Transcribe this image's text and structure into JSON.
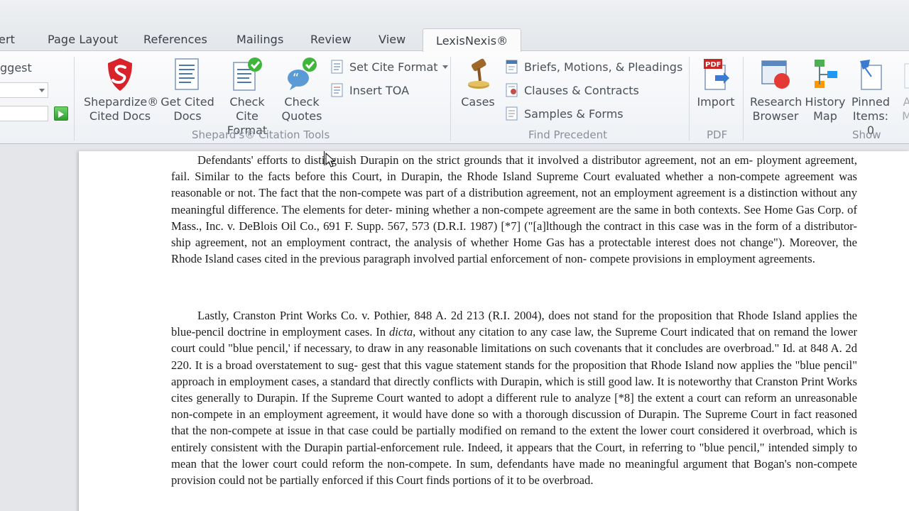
{
  "tabs": [
    {
      "label": "ert",
      "active": false
    },
    {
      "label": "Page Layout",
      "active": false
    },
    {
      "label": "References",
      "active": false
    },
    {
      "label": "Mailings",
      "active": false
    },
    {
      "label": "Review",
      "active": false
    },
    {
      "label": "View",
      "active": false
    },
    {
      "label": "LexisNexis®",
      "active": true
    }
  ],
  "ribbon": {
    "left": {
      "suggest_label": "ggest"
    },
    "citation_tools": {
      "group_label": "Shepard's® Citation Tools",
      "shepardize_line1": "Shepardize®",
      "shepardize_line2": "Cited Docs",
      "get_cite_line1": "Get Cited",
      "get_cite_line2": "Docs",
      "check_cite_line1": "Check Cite",
      "check_cite_line2": "Format",
      "check_quotes_line1": "Check",
      "check_quotes_line2": "Quotes",
      "set_cite_format": "Set Cite Format",
      "insert_toa": "Insert TOA"
    },
    "find_precedent": {
      "group_label": "Find Precedent",
      "cases": "Cases",
      "briefs": "Briefs, Motions, & Pleadings",
      "clauses": "Clauses & Contracts",
      "samples": "Samples & Forms"
    },
    "pdf": {
      "group_label": "PDF",
      "import": "Import"
    },
    "show": {
      "group_label": "Show",
      "research_line1": "Research",
      "research_line2": "Browser",
      "history_line1": "History",
      "history_line2": "Map",
      "pinned_line1": "Pinned",
      "pinned_line2": "Items: 0",
      "partial_line1": "A",
      "partial_line2": "M"
    }
  },
  "document": {
    "para1_lines": [
      "Defendants' efforts to distinguish Durapin on the strict grounds that it involved a distributor agreement, not an em-",
      "ployment agreement, fail. Similar to the facts before this Court, in Durapin, the Rhode Island Supreme Court evaluated",
      "whether a non-compete agreement was reasonable or not. The fact that the non-compete was part of a distribution",
      "agreement, not an employment agreement is a distinction without any meaningful difference. The elements for deter-",
      "mining whether a non-compete agreement are the same in both contexts. See Home Gas Corp. of Mass., Inc. v. DeBlois",
      "Oil Co., 691 F. Supp. 567, 573 (D.R.I. 1987) [*7] (\"[a]lthough the contract in this case was in the form of a distributor-",
      "ship agreement, not an employment contract, the analysis of whether Home Gas has a protectable interest does not",
      "change\"). Moreover, the Rhode Island cases cited in the previous paragraph involved partial enforcement of non-",
      "compete provisions in employment agreements."
    ],
    "para2_line2_pre": "Rhode Island applies the blue-pencil doctrine in employment cases. In ",
    "para2_line2_italic": "dicta",
    "para2_line2_post": ", without any citation to any case law, the",
    "para2_lines": [
      "Lastly, Cranston Print Works Co. v. Pothier, 848 A. 2d 213 (R.I. 2004), does not stand for the proposition that",
      "Supreme Court indicated that on remand the lower court could \"blue pencil,' if necessary, to draw in any reasonable",
      "limitations on such covenants that it concludes are overbroad.\" Id. at 848 A. 2d 220. It is a broad overstatement to sug-",
      "gest that this vague statement stands for the proposition that Rhode Island now applies the \"blue pencil\" approach in",
      "employment cases, a standard that directly conflicts with Durapin, which is still good law. It is noteworthy that",
      "Cranston Print Works cites generally to Durapin. If the Supreme Court wanted to adopt a different rule to analyze [*8]",
      "the extent a court can reform an unreasonable non-compete in an employment agreement, it would have done so with a",
      "thorough discussion of Durapin. The Supreme Court in fact reasoned that the non-compete at issue in that case could be",
      "partially modified on remand to the extent the lower court considered it overbroad, which is entirely consistent with the",
      "Durapin partial-enforcement rule. Indeed, it appears that the Court, in referring to \"blue pencil,\" intended simply to",
      "mean that the lower court could reform the non-compete. In sum, defendants have made no meaningful argument that",
      "Bogan's non-compete provision could not be partially enforced if this Court finds portions of it to be overbroad."
    ]
  }
}
